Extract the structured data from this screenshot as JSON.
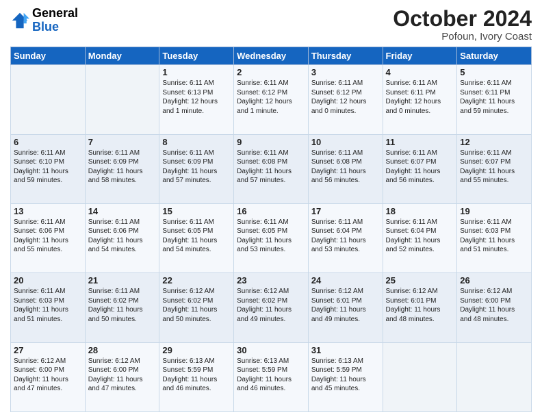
{
  "header": {
    "logo": {
      "line1": "General",
      "line2": "Blue"
    },
    "month": "October 2024",
    "location": "Pofoun, Ivory Coast"
  },
  "weekdays": [
    "Sunday",
    "Monday",
    "Tuesday",
    "Wednesday",
    "Thursday",
    "Friday",
    "Saturday"
  ],
  "weeks": [
    [
      {
        "day": "",
        "text": ""
      },
      {
        "day": "",
        "text": ""
      },
      {
        "day": "1",
        "text": "Sunrise: 6:11 AM\nSunset: 6:13 PM\nDaylight: 12 hours\nand 1 minute."
      },
      {
        "day": "2",
        "text": "Sunrise: 6:11 AM\nSunset: 6:12 PM\nDaylight: 12 hours\nand 1 minute."
      },
      {
        "day": "3",
        "text": "Sunrise: 6:11 AM\nSunset: 6:12 PM\nDaylight: 12 hours\nand 0 minutes."
      },
      {
        "day": "4",
        "text": "Sunrise: 6:11 AM\nSunset: 6:11 PM\nDaylight: 12 hours\nand 0 minutes."
      },
      {
        "day": "5",
        "text": "Sunrise: 6:11 AM\nSunset: 6:11 PM\nDaylight: 11 hours\nand 59 minutes."
      }
    ],
    [
      {
        "day": "6",
        "text": "Sunrise: 6:11 AM\nSunset: 6:10 PM\nDaylight: 11 hours\nand 59 minutes."
      },
      {
        "day": "7",
        "text": "Sunrise: 6:11 AM\nSunset: 6:09 PM\nDaylight: 11 hours\nand 58 minutes."
      },
      {
        "day": "8",
        "text": "Sunrise: 6:11 AM\nSunset: 6:09 PM\nDaylight: 11 hours\nand 57 minutes."
      },
      {
        "day": "9",
        "text": "Sunrise: 6:11 AM\nSunset: 6:08 PM\nDaylight: 11 hours\nand 57 minutes."
      },
      {
        "day": "10",
        "text": "Sunrise: 6:11 AM\nSunset: 6:08 PM\nDaylight: 11 hours\nand 56 minutes."
      },
      {
        "day": "11",
        "text": "Sunrise: 6:11 AM\nSunset: 6:07 PM\nDaylight: 11 hours\nand 56 minutes."
      },
      {
        "day": "12",
        "text": "Sunrise: 6:11 AM\nSunset: 6:07 PM\nDaylight: 11 hours\nand 55 minutes."
      }
    ],
    [
      {
        "day": "13",
        "text": "Sunrise: 6:11 AM\nSunset: 6:06 PM\nDaylight: 11 hours\nand 55 minutes."
      },
      {
        "day": "14",
        "text": "Sunrise: 6:11 AM\nSunset: 6:06 PM\nDaylight: 11 hours\nand 54 minutes."
      },
      {
        "day": "15",
        "text": "Sunrise: 6:11 AM\nSunset: 6:05 PM\nDaylight: 11 hours\nand 54 minutes."
      },
      {
        "day": "16",
        "text": "Sunrise: 6:11 AM\nSunset: 6:05 PM\nDaylight: 11 hours\nand 53 minutes."
      },
      {
        "day": "17",
        "text": "Sunrise: 6:11 AM\nSunset: 6:04 PM\nDaylight: 11 hours\nand 53 minutes."
      },
      {
        "day": "18",
        "text": "Sunrise: 6:11 AM\nSunset: 6:04 PM\nDaylight: 11 hours\nand 52 minutes."
      },
      {
        "day": "19",
        "text": "Sunrise: 6:11 AM\nSunset: 6:03 PM\nDaylight: 11 hours\nand 51 minutes."
      }
    ],
    [
      {
        "day": "20",
        "text": "Sunrise: 6:11 AM\nSunset: 6:03 PM\nDaylight: 11 hours\nand 51 minutes."
      },
      {
        "day": "21",
        "text": "Sunrise: 6:11 AM\nSunset: 6:02 PM\nDaylight: 11 hours\nand 50 minutes."
      },
      {
        "day": "22",
        "text": "Sunrise: 6:12 AM\nSunset: 6:02 PM\nDaylight: 11 hours\nand 50 minutes."
      },
      {
        "day": "23",
        "text": "Sunrise: 6:12 AM\nSunset: 6:02 PM\nDaylight: 11 hours\nand 49 minutes."
      },
      {
        "day": "24",
        "text": "Sunrise: 6:12 AM\nSunset: 6:01 PM\nDaylight: 11 hours\nand 49 minutes."
      },
      {
        "day": "25",
        "text": "Sunrise: 6:12 AM\nSunset: 6:01 PM\nDaylight: 11 hours\nand 48 minutes."
      },
      {
        "day": "26",
        "text": "Sunrise: 6:12 AM\nSunset: 6:00 PM\nDaylight: 11 hours\nand 48 minutes."
      }
    ],
    [
      {
        "day": "27",
        "text": "Sunrise: 6:12 AM\nSunset: 6:00 PM\nDaylight: 11 hours\nand 47 minutes."
      },
      {
        "day": "28",
        "text": "Sunrise: 6:12 AM\nSunset: 6:00 PM\nDaylight: 11 hours\nand 47 minutes."
      },
      {
        "day": "29",
        "text": "Sunrise: 6:13 AM\nSunset: 5:59 PM\nDaylight: 11 hours\nand 46 minutes."
      },
      {
        "day": "30",
        "text": "Sunrise: 6:13 AM\nSunset: 5:59 PM\nDaylight: 11 hours\nand 46 minutes."
      },
      {
        "day": "31",
        "text": "Sunrise: 6:13 AM\nSunset: 5:59 PM\nDaylight: 11 hours\nand 45 minutes."
      },
      {
        "day": "",
        "text": ""
      },
      {
        "day": "",
        "text": ""
      }
    ]
  ]
}
